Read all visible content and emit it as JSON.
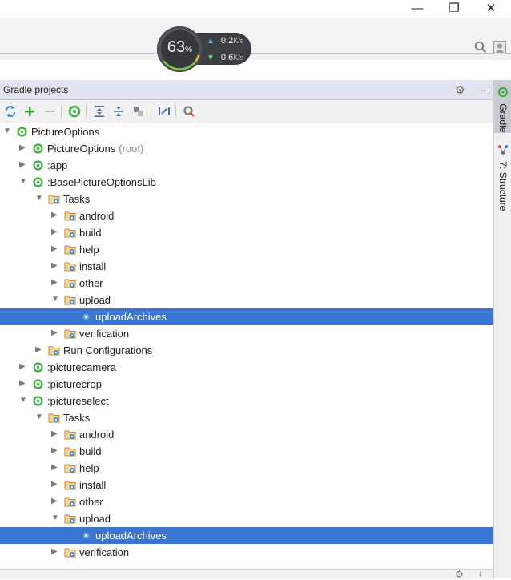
{
  "window": {
    "minimize_glyph": "—",
    "maximize_glyph": "❐",
    "close_glyph": "✕"
  },
  "speed": {
    "percent": "63",
    "percent_unit": "%",
    "upload_value": "0.2",
    "download_value": "0.6",
    "unit": "K/s"
  },
  "panel": {
    "title": "Gradle projects"
  },
  "side_tabs": {
    "gradle": "Gradle",
    "structure": "7: Structure"
  },
  "tree": [
    {
      "label": "PictureOptions",
      "depth": 0,
      "expanded": true,
      "icon": "gradle-project-icon"
    },
    {
      "label": "PictureOptions",
      "suffix": "(root)",
      "depth": 1,
      "expanded": false,
      "icon": "gradle-module-icon"
    },
    {
      "label": ":app",
      "depth": 1,
      "expanded": false,
      "icon": "gradle-module-icon"
    },
    {
      "label": ":BasePictureOptionsLib",
      "depth": 1,
      "expanded": true,
      "icon": "gradle-module-icon"
    },
    {
      "label": "Tasks",
      "depth": 2,
      "expanded": true,
      "icon": "task-folder-icon"
    },
    {
      "label": "android",
      "depth": 3,
      "expanded": false,
      "icon": "task-folder-icon"
    },
    {
      "label": "build",
      "depth": 3,
      "expanded": false,
      "icon": "task-folder-icon"
    },
    {
      "label": "help",
      "depth": 3,
      "expanded": false,
      "icon": "task-folder-icon"
    },
    {
      "label": "install",
      "depth": 3,
      "expanded": false,
      "icon": "task-folder-icon"
    },
    {
      "label": "other",
      "depth": 3,
      "expanded": false,
      "icon": "task-folder-icon"
    },
    {
      "label": "upload",
      "depth": 3,
      "expanded": true,
      "icon": "task-folder-icon"
    },
    {
      "label": "uploadArchives",
      "depth": 4,
      "leaf": true,
      "selected": true,
      "icon": "gear-task-icon"
    },
    {
      "label": "verification",
      "depth": 3,
      "expanded": false,
      "icon": "task-folder-icon"
    },
    {
      "label": "Run Configurations",
      "depth": 2,
      "expanded": false,
      "icon": "task-folder-icon"
    },
    {
      "label": ":picturecamera",
      "depth": 1,
      "expanded": false,
      "icon": "gradle-module-icon"
    },
    {
      "label": ":picturecrop",
      "depth": 1,
      "expanded": false,
      "icon": "gradle-module-icon"
    },
    {
      "label": ":pictureselect",
      "depth": 1,
      "expanded": true,
      "icon": "gradle-module-icon"
    },
    {
      "label": "Tasks",
      "depth": 2,
      "expanded": true,
      "icon": "task-folder-icon"
    },
    {
      "label": "android",
      "depth": 3,
      "expanded": false,
      "icon": "task-folder-icon"
    },
    {
      "label": "build",
      "depth": 3,
      "expanded": false,
      "icon": "task-folder-icon"
    },
    {
      "label": "help",
      "depth": 3,
      "expanded": false,
      "icon": "task-folder-icon"
    },
    {
      "label": "install",
      "depth": 3,
      "expanded": false,
      "icon": "task-folder-icon"
    },
    {
      "label": "other",
      "depth": 3,
      "expanded": false,
      "icon": "task-folder-icon"
    },
    {
      "label": "upload",
      "depth": 3,
      "expanded": true,
      "icon": "task-folder-icon"
    },
    {
      "label": "uploadArchives",
      "depth": 4,
      "leaf": true,
      "selected": true,
      "icon": "gear-task-icon"
    },
    {
      "label": "verification",
      "depth": 3,
      "expanded": false,
      "icon": "task-folder-icon"
    }
  ],
  "colors": {
    "selection": "#3a75d4",
    "gradle_green": "#3fae3f",
    "folder": "#c48a3a",
    "panel_header": "#dfe6f1"
  }
}
